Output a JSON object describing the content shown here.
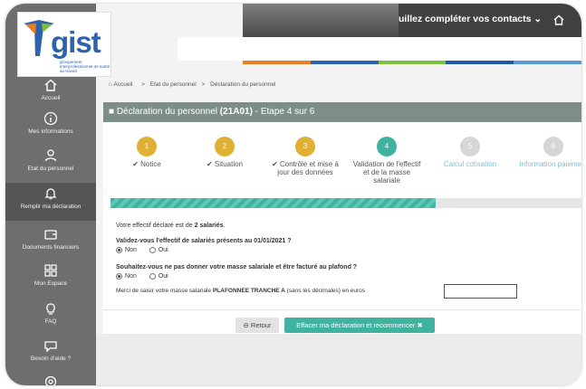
{
  "logo": {
    "word": "gist",
    "tagline": "groupement interprofessionnel de santé au travail"
  },
  "header": {
    "notice": "uillez compléter vos contacts ⌄"
  },
  "colors": {
    "teal": "#3fb3a0",
    "gold": "#e0b034",
    "gray_step": "#d6d6d6",
    "blue_step": "#7fc1d6"
  },
  "color_strip": [
    "#e67e22",
    "#2d63ad",
    "#7fbf3f",
    "#1e5aa8",
    "#5b9bd5"
  ],
  "sidebar": {
    "items": [
      {
        "label": "Accueil",
        "icon": "home-icon"
      },
      {
        "label": "Mes informations",
        "icon": "info-icon"
      },
      {
        "label": "Etat du personnel",
        "icon": "users-icon"
      },
      {
        "label": "Remplir ma déclaration",
        "icon": "bell-icon"
      },
      {
        "label": "Documents financiers",
        "icon": "wallet-icon"
      },
      {
        "label": "Mon Espace",
        "icon": "grid-icon"
      },
      {
        "label": "FAQ",
        "icon": "lightbulb-icon"
      },
      {
        "label": "Besoin d'aide ?",
        "icon": "chat-icon"
      }
    ]
  },
  "breadcrumb": {
    "home": "Accueil",
    "sep": ">",
    "level1": "Etat du personnel",
    "level2": "Déclaration du personnel"
  },
  "card": {
    "title_prefix": "Déclaration du personnel ",
    "title_code": "(21A01)",
    "title_suffix": " - Etape 4 sur 6"
  },
  "steps": [
    {
      "num": "1",
      "label": "✔ Notice"
    },
    {
      "num": "2",
      "label": "✔ Situation"
    },
    {
      "num": "3",
      "label": "✔ Contrôle et mise à jour des données"
    },
    {
      "num": "4",
      "label": "Validation de l'effectif et de la masse salariale"
    },
    {
      "num": "5",
      "label": "Calcul cotisation"
    },
    {
      "num": "6",
      "label": "Information paiement"
    }
  ],
  "progress_fraction": 0.69,
  "form": {
    "effectif_prefix": "Votre effectif déclaré est de ",
    "effectif_value": "2 salariés",
    "effectif_suffix": ".",
    "q1": "Validez-vous l'effectif de salariés présents au 01/01/2021 ?",
    "q2": "Souhaitez-vous ne pas donner votre masse salariale et être facturé au plafond ?",
    "opt_non": "Non",
    "opt_oui": "Oui",
    "amount_prefix": "Merci de saisir votre masse salariale ",
    "amount_bold": "PLAFONNEE TRANCHE A",
    "amount_suffix": " (sans les décimales) en euros"
  },
  "buttons": {
    "back": "⊖ Retour",
    "reset": "Effacer ma déclaration et recommencer ✖"
  }
}
